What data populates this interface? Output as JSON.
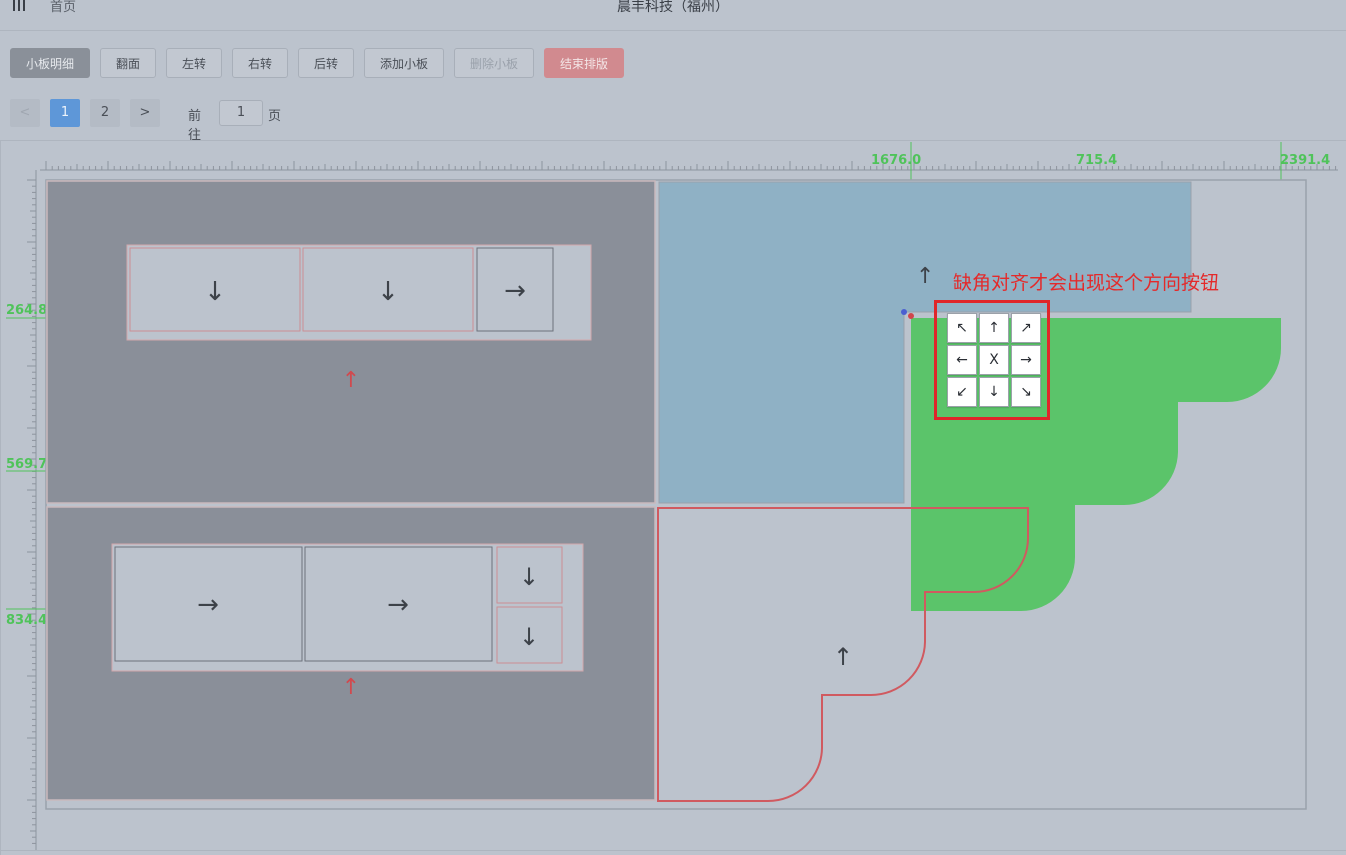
{
  "header": {
    "home": "首页",
    "title": "晨丰科技（福州）"
  },
  "toolbar": {
    "detail": "小板明细",
    "flip": "翻面",
    "rotate_left": "左转",
    "rotate_right": "右转",
    "rotate_back": "后转",
    "add_piece": "添加小板",
    "delete_piece": "删除小板",
    "finish": "结束排版"
  },
  "pager": {
    "prev": "<",
    "pages": [
      "1",
      "2"
    ],
    "current": "1",
    "next": ">",
    "goto_label": "前往",
    "goto_value": "1",
    "unit": "页"
  },
  "ruler": {
    "top_labels": [
      "1676.0",
      "715.4",
      "2391.4"
    ],
    "left_labels": [
      "264.8",
      "569.7",
      "834.4"
    ]
  },
  "board": {
    "piece_arrows_row1": [
      "↓",
      "↓",
      "→"
    ],
    "piece_arrows_row2": [
      "→",
      "→",
      "↓",
      "↓"
    ],
    "origin_arrow": "↑",
    "outline_arrow": "↑",
    "up_hint": "↑"
  },
  "annotation": {
    "text": "缺角对齐才会出现这个方向按钮"
  },
  "direction_pad": [
    "↖",
    "↑",
    "↗",
    "←",
    "X",
    "→",
    "↙",
    "↓",
    "↘"
  ],
  "colors": {
    "background": "#bcc3cd",
    "dark_panel": "#8a8f99",
    "blue_panel": "#8fb1c5",
    "green_shape": "#5bc46a",
    "red_outline": "#d05a60",
    "ruler_text": "#4fc35a",
    "annotation": "#e42a2a",
    "primary_button": "#8a9099",
    "active_page": "#5e97d8",
    "danger_button": "#d18a8f"
  }
}
